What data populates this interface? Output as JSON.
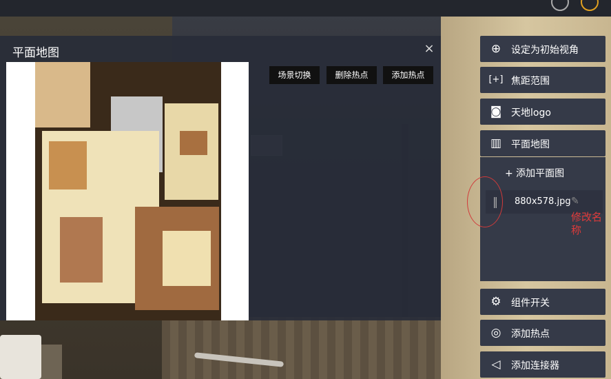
{
  "panel": {
    "title": "平面地图",
    "close_label": "×",
    "buttons": {
      "scene_switch": "场景切换",
      "delete_hotspot": "删除热点",
      "add_hotspot": "添加热点"
    }
  },
  "sidebar": {
    "items": [
      {
        "label": "设定为初始视角",
        "icon": "crosshair-icon",
        "glyph": "⊕"
      },
      {
        "label": "焦距范围",
        "icon": "focus-range-icon",
        "glyph": "[+]"
      },
      {
        "label": "天地logo",
        "icon": "image-icon",
        "glyph": "◙"
      },
      {
        "label": "平面地图",
        "icon": "map-icon",
        "glyph": "▥"
      },
      {
        "label": "组件开关",
        "icon": "gear-icon",
        "glyph": "⚙"
      },
      {
        "label": "添加热点",
        "icon": "target-icon",
        "glyph": "◎"
      },
      {
        "label": "添加连接器",
        "icon": "send-icon",
        "glyph": "◁"
      }
    ],
    "floorplan": {
      "add_label": "+ 添加平面图",
      "files": [
        {
          "name": "880x578.jpg",
          "handle_glyph": "‖",
          "edit_glyph": "✎"
        }
      ]
    }
  },
  "annotation": {
    "note": "修改名称"
  }
}
